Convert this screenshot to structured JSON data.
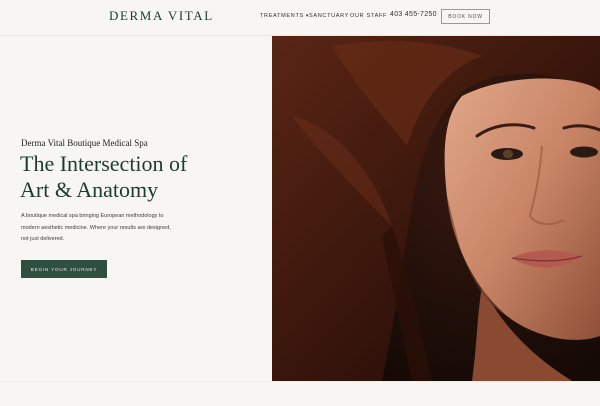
{
  "header": {
    "logo": "DERMA VITAL",
    "nav": [
      {
        "label": "TREATMENTS",
        "icon": "chevron-down-icon"
      },
      {
        "label": "SANCTUARY"
      },
      {
        "label": "OUR STAFF"
      }
    ],
    "phone": "403 455-7250",
    "book_label": "BOOK NOW"
  },
  "hero": {
    "subtitle": "Derma Vital Boutique Medical Spa",
    "headline_line1": "The Intersection of",
    "headline_line2": "Art & Anatomy",
    "body": "A boutique medical spa bringing European methodology to modern aesthetic medicine. Where your results are designed, not just delivered.",
    "cta_label": "BEGIN YOUR JOURNEY",
    "image": "portrait-photo"
  },
  "colors": {
    "brand_green": "#2f4f3f",
    "heading_green": "#1d3b2e",
    "background": "#f8f6f3"
  }
}
